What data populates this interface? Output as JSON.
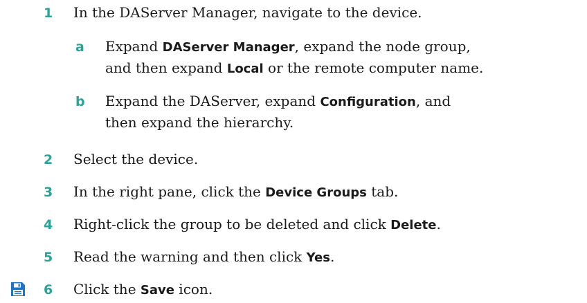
{
  "steps": [
    {
      "num": "1",
      "parts": [
        {
          "t": "In the DAServer Manager, navigate to the device.",
          "bold": false
        }
      ]
    },
    {
      "num": "2",
      "parts": [
        {
          "t": "Select the device.",
          "bold": false
        }
      ]
    },
    {
      "num": "3",
      "parts": [
        {
          "t": "In the right pane, click the ",
          "bold": false
        },
        {
          "t": "Device Groups",
          "bold": true
        },
        {
          "t": " tab.",
          "bold": false
        }
      ]
    },
    {
      "num": "4",
      "parts": [
        {
          "t": "Right-click the group to be deleted and click ",
          "bold": false
        },
        {
          "t": "Delete",
          "bold": true
        },
        {
          "t": ".",
          "bold": false
        }
      ]
    },
    {
      "num": "5",
      "parts": [
        {
          "t": "Read the warning and then click ",
          "bold": false
        },
        {
          "t": "Yes",
          "bold": true
        },
        {
          "t": ".",
          "bold": false
        }
      ]
    },
    {
      "num": "6",
      "parts": [
        {
          "t": "Click the ",
          "bold": false
        },
        {
          "t": "Save",
          "bold": true
        },
        {
          "t": " icon.",
          "bold": false
        }
      ]
    }
  ],
  "substeps": [
    {
      "num": "a",
      "lines": [
        [
          {
            "t": "Expand ",
            "bold": false
          },
          {
            "t": "DAServer Manager",
            "bold": true
          },
          {
            "t": ", expand the node group,",
            "bold": false
          }
        ],
        [
          {
            "t": "and then expand ",
            "bold": false
          },
          {
            "t": "Local",
            "bold": true
          },
          {
            "t": " or the remote computer name.",
            "bold": false
          }
        ]
      ]
    },
    {
      "num": "b",
      "lines": [
        [
          {
            "t": "Expand the DAServer, expand ",
            "bold": false
          },
          {
            "t": "Configuration",
            "bold": true
          },
          {
            "t": ", and",
            "bold": false
          }
        ],
        [
          {
            "t": "then expand the hierarchy.",
            "bold": false
          }
        ]
      ]
    }
  ],
  "save_icon": {
    "name": "save-icon",
    "color": "#1f75c4"
  },
  "colors": {
    "step_number": "#2aa39a",
    "text": "#1a1a1a"
  }
}
